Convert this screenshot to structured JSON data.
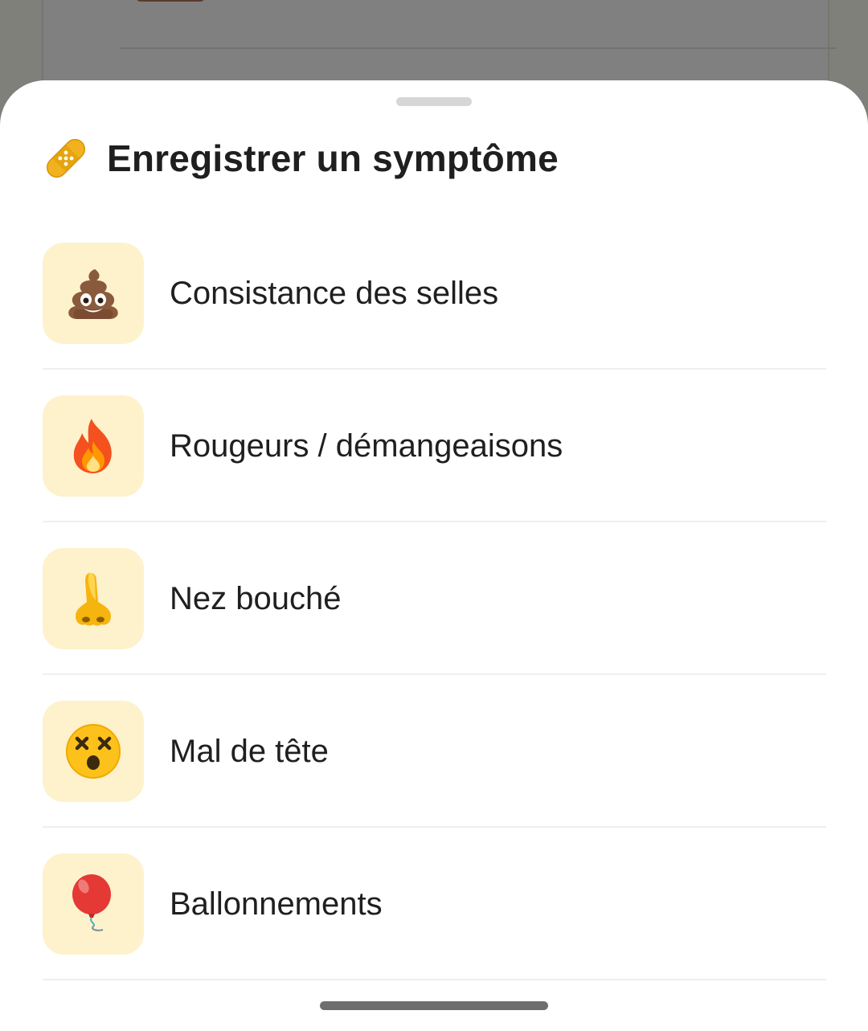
{
  "sheet": {
    "title": "Enregistrer un symptôme",
    "title_icon": "bandage-icon"
  },
  "symptoms": [
    {
      "label": "Consistance des selles",
      "icon": "poop-icon"
    },
    {
      "label": "Rougeurs / démangeaisons",
      "icon": "fire-icon"
    },
    {
      "label": "Nez bouché",
      "icon": "nose-icon"
    },
    {
      "label": "Mal de tête",
      "icon": "dizzy-face-icon"
    },
    {
      "label": "Ballonnements",
      "icon": "balloon-icon"
    }
  ],
  "colors": {
    "icon_tile_bg": "#fdf2cc",
    "sheet_bg": "#ffffff",
    "scrim": "#7f8079",
    "text": "#1f1f1f"
  }
}
